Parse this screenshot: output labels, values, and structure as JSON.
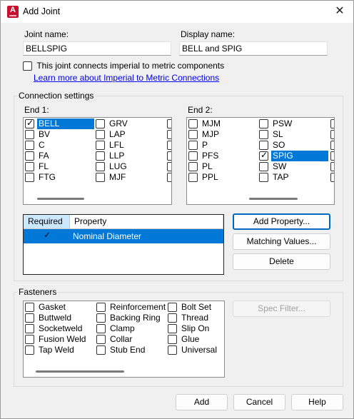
{
  "window": {
    "title": "Add Joint",
    "app_icon_letter": "A"
  },
  "joint_name": {
    "label": "Joint name:",
    "value": "BELLSPIG"
  },
  "display_name": {
    "label": "Display name:",
    "value": "BELL and SPIG"
  },
  "imperial_metric": {
    "label": "This joint connects imperial to metric components",
    "checked": false,
    "link": "Learn more about Imperial to Metric Connections"
  },
  "connection_settings": {
    "title": "Connection settings",
    "end1": {
      "label": "End 1:",
      "col1": [
        {
          "label": "BELL",
          "checked": true,
          "selected": true
        },
        {
          "label": "BV",
          "checked": false
        },
        {
          "label": "C",
          "checked": false
        },
        {
          "label": "FA",
          "checked": false
        },
        {
          "label": "FL",
          "checked": false
        },
        {
          "label": "FTG",
          "checked": false
        }
      ],
      "col2": [
        {
          "label": "GRV",
          "checked": false
        },
        {
          "label": "LAP",
          "checked": false
        },
        {
          "label": "LFL",
          "checked": false
        },
        {
          "label": "LLP",
          "checked": false
        },
        {
          "label": "LUG",
          "checked": false
        },
        {
          "label": "MJF",
          "checked": false
        }
      ]
    },
    "end2": {
      "label": "End 2:",
      "col1": [
        {
          "label": "MJM",
          "checked": false
        },
        {
          "label": "MJP",
          "checked": false
        },
        {
          "label": "P",
          "checked": false
        },
        {
          "label": "PFS",
          "checked": false
        },
        {
          "label": "PL",
          "checked": false
        },
        {
          "label": "PPL",
          "checked": false
        }
      ],
      "col2": [
        {
          "label": "PSW",
          "checked": false
        },
        {
          "label": "SL",
          "checked": false
        },
        {
          "label": "SO",
          "checked": false
        },
        {
          "label": "SPIG",
          "checked": true,
          "selected": true
        },
        {
          "label": "SW",
          "checked": false
        },
        {
          "label": "TAP",
          "checked": false
        }
      ]
    },
    "property_table": {
      "headers": [
        "Required",
        "Property"
      ],
      "rows": [
        {
          "required": true,
          "property": "Nominal Diameter"
        }
      ]
    },
    "buttons": {
      "add_property": "Add Property...",
      "matching_values": "Matching Values...",
      "delete": "Delete"
    }
  },
  "fasteners": {
    "title": "Fasteners",
    "col1": [
      "Gasket",
      "Buttweld",
      "Socketweld",
      "Fusion Weld",
      "Tap Weld"
    ],
    "col2": [
      "Reinforcement R",
      "Backing Ring",
      "Clamp",
      "Collar",
      "Stub End"
    ],
    "col3": [
      "Bolt Set",
      "Thread",
      "Slip On",
      "Glue",
      "Universal"
    ],
    "spec_filter": "Spec Filter..."
  },
  "footer": {
    "add": "Add",
    "cancel": "Cancel",
    "help": "Help"
  },
  "colors": {
    "selection": "#0078d7",
    "link": "#0000ee",
    "brand": "#c8102e"
  }
}
